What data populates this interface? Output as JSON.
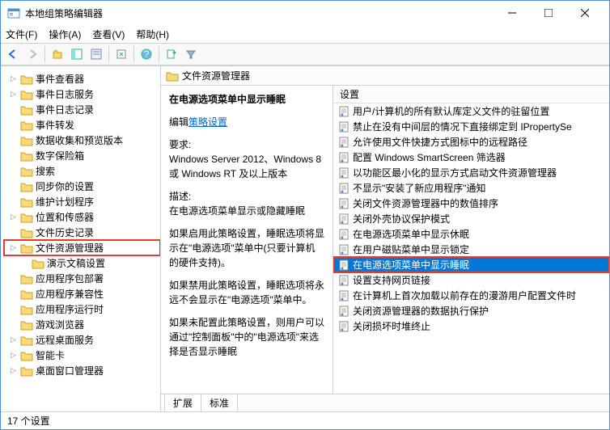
{
  "window": {
    "title": "本地组策略编辑器"
  },
  "menu": {
    "file": "文件(F)",
    "action": "操作(A)",
    "view": "查看(V)",
    "help": "帮助(H)"
  },
  "tree": {
    "items": [
      {
        "label": "事件查看器",
        "arrow": "▷",
        "sub": false
      },
      {
        "label": "事件日志服务",
        "arrow": "▷",
        "sub": false
      },
      {
        "label": "事件日志记录",
        "arrow": "",
        "sub": false
      },
      {
        "label": "事件转发",
        "arrow": "",
        "sub": false
      },
      {
        "label": "数据收集和预览版本",
        "arrow": "",
        "sub": false
      },
      {
        "label": "数字保险箱",
        "arrow": "",
        "sub": false
      },
      {
        "label": "搜索",
        "arrow": "",
        "sub": false
      },
      {
        "label": "同步你的设置",
        "arrow": "",
        "sub": false
      },
      {
        "label": "维护计划程序",
        "arrow": "",
        "sub": false
      },
      {
        "label": "位置和传感器",
        "arrow": "▷",
        "sub": false
      },
      {
        "label": "文件历史记录",
        "arrow": "",
        "sub": false
      },
      {
        "label": "文件资源管理器",
        "arrow": "▷",
        "sub": false,
        "selected": true
      },
      {
        "label": "演示文稿设置",
        "arrow": "",
        "sub": true
      },
      {
        "label": "应用程序包部署",
        "arrow": "",
        "sub": false
      },
      {
        "label": "应用程序兼容性",
        "arrow": "",
        "sub": false
      },
      {
        "label": "应用程序运行时",
        "arrow": "",
        "sub": false
      },
      {
        "label": "游戏浏览器",
        "arrow": "",
        "sub": false
      },
      {
        "label": "远程桌面服务",
        "arrow": "▷",
        "sub": false
      },
      {
        "label": "智能卡",
        "arrow": "▷",
        "sub": false
      },
      {
        "label": "桌面窗口管理器",
        "arrow": "▷",
        "sub": false
      }
    ]
  },
  "content": {
    "header": "文件资源管理器",
    "desc": {
      "title": "在电源选项菜单中显示睡眠",
      "edit_prefix": "编辑",
      "edit_link": "策略设置",
      "req_label": "要求:",
      "req_text": "Windows Server 2012、Windows 8 或 Windows RT 及以上版本",
      "desc_label": "描述:",
      "desc_text": "在电源选项菜单显示或隐藏睡眠",
      "p1": "如果启用此策略设置，睡眠选项将显示在\"电源选项\"菜单中(只要计算机的硬件支持)。",
      "p2": "如果禁用此策略设置，睡眠选项将永远不会显示在\"电源选项\"菜单中。",
      "p3": "如果未配置此策略设置，则用户可以通过\"控制面板\"中的\"电源选项\"来选择是否显示睡眠"
    },
    "list_header": "设置",
    "settings": [
      "用户/计算机的所有默认库定义文件的驻留位置",
      "禁止在没有中间层的情况下直接绑定到 IPropertySe",
      "允许使用文件快捷方式图标中的远程路径",
      "配置 Windows SmartScreen 筛选器",
      "以功能区最小化的显示方式启动文件资源管理器",
      "不显示\"安装了新应用程序\"通知",
      "关闭文件资源管理器中的数值排序",
      "关闭外壳协议保护模式",
      "在电源选项菜单中显示休眠",
      "在用户磁贴菜单中显示锁定",
      "在电源选项菜单中显示睡眠",
      "设置支持网页链接",
      "在计算机上首次加载以前存在的漫游用户配置文件时",
      "关闭资源管理器的数据执行保护",
      "关闭损坏时堆终止"
    ],
    "highlighted_index": 10,
    "tabs": {
      "extended": "扩展",
      "standard": "标准"
    }
  },
  "status": "17 个设置"
}
